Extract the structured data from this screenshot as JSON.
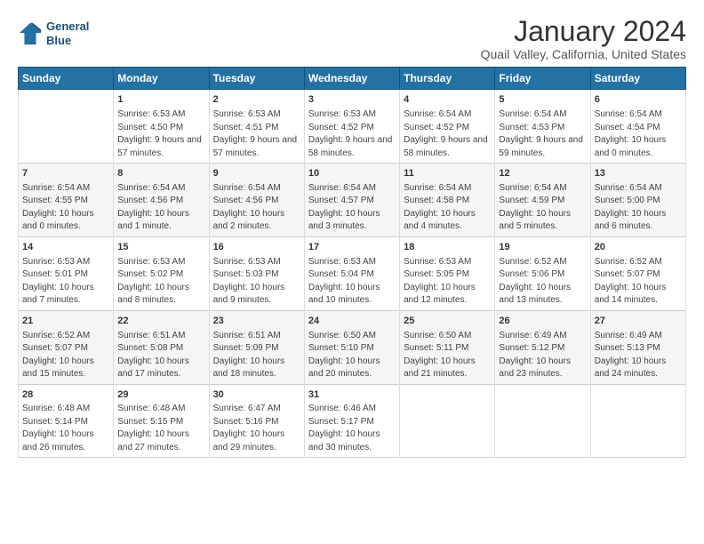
{
  "header": {
    "logo_line1": "General",
    "logo_line2": "Blue",
    "title": "January 2024",
    "subtitle": "Quail Valley, California, United States"
  },
  "days_of_week": [
    "Sunday",
    "Monday",
    "Tuesday",
    "Wednesday",
    "Thursday",
    "Friday",
    "Saturday"
  ],
  "weeks": [
    [
      {
        "num": "",
        "sunrise": "",
        "sunset": "",
        "daylight": ""
      },
      {
        "num": "1",
        "sunrise": "6:53 AM",
        "sunset": "4:50 PM",
        "daylight": "9 hours and 57 minutes."
      },
      {
        "num": "2",
        "sunrise": "6:53 AM",
        "sunset": "4:51 PM",
        "daylight": "9 hours and 57 minutes."
      },
      {
        "num": "3",
        "sunrise": "6:53 AM",
        "sunset": "4:52 PM",
        "daylight": "9 hours and 58 minutes."
      },
      {
        "num": "4",
        "sunrise": "6:54 AM",
        "sunset": "4:52 PM",
        "daylight": "9 hours and 58 minutes."
      },
      {
        "num": "5",
        "sunrise": "6:54 AM",
        "sunset": "4:53 PM",
        "daylight": "9 hours and 59 minutes."
      },
      {
        "num": "6",
        "sunrise": "6:54 AM",
        "sunset": "4:54 PM",
        "daylight": "10 hours and 0 minutes."
      }
    ],
    [
      {
        "num": "7",
        "sunrise": "6:54 AM",
        "sunset": "4:55 PM",
        "daylight": "10 hours and 0 minutes."
      },
      {
        "num": "8",
        "sunrise": "6:54 AM",
        "sunset": "4:56 PM",
        "daylight": "10 hours and 1 minute."
      },
      {
        "num": "9",
        "sunrise": "6:54 AM",
        "sunset": "4:56 PM",
        "daylight": "10 hours and 2 minutes."
      },
      {
        "num": "10",
        "sunrise": "6:54 AM",
        "sunset": "4:57 PM",
        "daylight": "10 hours and 3 minutes."
      },
      {
        "num": "11",
        "sunrise": "6:54 AM",
        "sunset": "4:58 PM",
        "daylight": "10 hours and 4 minutes."
      },
      {
        "num": "12",
        "sunrise": "6:54 AM",
        "sunset": "4:59 PM",
        "daylight": "10 hours and 5 minutes."
      },
      {
        "num": "13",
        "sunrise": "6:54 AM",
        "sunset": "5:00 PM",
        "daylight": "10 hours and 6 minutes."
      }
    ],
    [
      {
        "num": "14",
        "sunrise": "6:53 AM",
        "sunset": "5:01 PM",
        "daylight": "10 hours and 7 minutes."
      },
      {
        "num": "15",
        "sunrise": "6:53 AM",
        "sunset": "5:02 PM",
        "daylight": "10 hours and 8 minutes."
      },
      {
        "num": "16",
        "sunrise": "6:53 AM",
        "sunset": "5:03 PM",
        "daylight": "10 hours and 9 minutes."
      },
      {
        "num": "17",
        "sunrise": "6:53 AM",
        "sunset": "5:04 PM",
        "daylight": "10 hours and 10 minutes."
      },
      {
        "num": "18",
        "sunrise": "6:53 AM",
        "sunset": "5:05 PM",
        "daylight": "10 hours and 12 minutes."
      },
      {
        "num": "19",
        "sunrise": "6:52 AM",
        "sunset": "5:06 PM",
        "daylight": "10 hours and 13 minutes."
      },
      {
        "num": "20",
        "sunrise": "6:52 AM",
        "sunset": "5:07 PM",
        "daylight": "10 hours and 14 minutes."
      }
    ],
    [
      {
        "num": "21",
        "sunrise": "6:52 AM",
        "sunset": "5:07 PM",
        "daylight": "10 hours and 15 minutes."
      },
      {
        "num": "22",
        "sunrise": "6:51 AM",
        "sunset": "5:08 PM",
        "daylight": "10 hours and 17 minutes."
      },
      {
        "num": "23",
        "sunrise": "6:51 AM",
        "sunset": "5:09 PM",
        "daylight": "10 hours and 18 minutes."
      },
      {
        "num": "24",
        "sunrise": "6:50 AM",
        "sunset": "5:10 PM",
        "daylight": "10 hours and 20 minutes."
      },
      {
        "num": "25",
        "sunrise": "6:50 AM",
        "sunset": "5:11 PM",
        "daylight": "10 hours and 21 minutes."
      },
      {
        "num": "26",
        "sunrise": "6:49 AM",
        "sunset": "5:12 PM",
        "daylight": "10 hours and 23 minutes."
      },
      {
        "num": "27",
        "sunrise": "6:49 AM",
        "sunset": "5:13 PM",
        "daylight": "10 hours and 24 minutes."
      }
    ],
    [
      {
        "num": "28",
        "sunrise": "6:48 AM",
        "sunset": "5:14 PM",
        "daylight": "10 hours and 26 minutes."
      },
      {
        "num": "29",
        "sunrise": "6:48 AM",
        "sunset": "5:15 PM",
        "daylight": "10 hours and 27 minutes."
      },
      {
        "num": "30",
        "sunrise": "6:47 AM",
        "sunset": "5:16 PM",
        "daylight": "10 hours and 29 minutes."
      },
      {
        "num": "31",
        "sunrise": "6:46 AM",
        "sunset": "5:17 PM",
        "daylight": "10 hours and 30 minutes."
      },
      {
        "num": "",
        "sunrise": "",
        "sunset": "",
        "daylight": ""
      },
      {
        "num": "",
        "sunrise": "",
        "sunset": "",
        "daylight": ""
      },
      {
        "num": "",
        "sunrise": "",
        "sunset": "",
        "daylight": ""
      }
    ]
  ]
}
